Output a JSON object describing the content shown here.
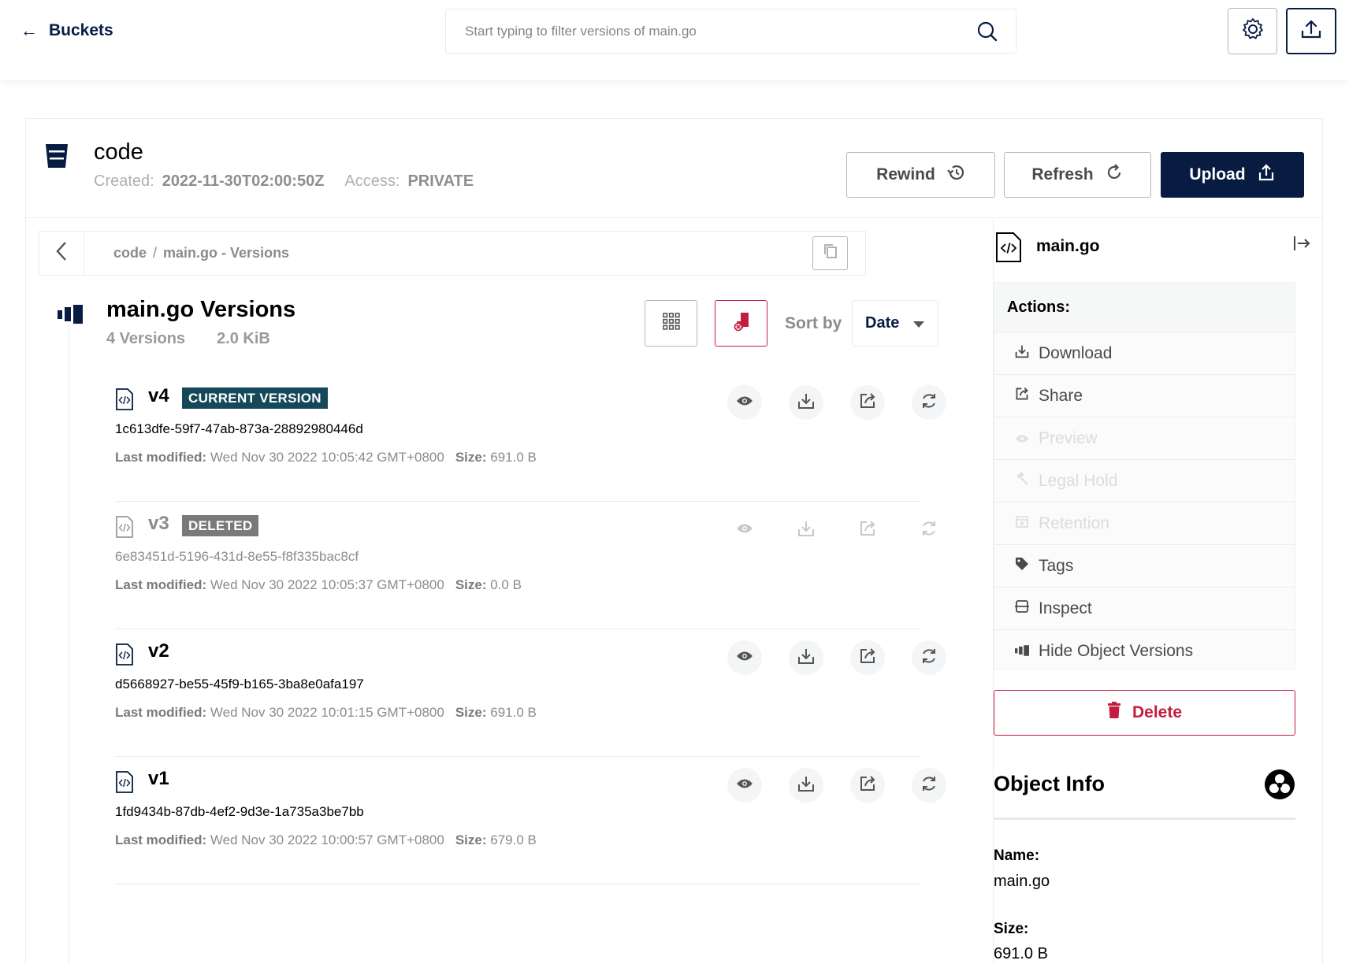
{
  "topbar": {
    "back_label": "Buckets",
    "search_placeholder": "Start typing to filter versions of main.go"
  },
  "bucket": {
    "name": "code",
    "created_label": "Created:",
    "created_value": "2022-11-30T02:00:50Z",
    "access_label": "Access:",
    "access_value": "PRIVATE",
    "buttons": {
      "rewind": "Rewind",
      "refresh": "Refresh",
      "upload": "Upload"
    }
  },
  "breadcrumb": {
    "root": "code",
    "separator": "/",
    "current": "main.go - Versions"
  },
  "versions": {
    "title": "main.go Versions",
    "count": "4 Versions",
    "size": "2.0 KiB",
    "sort_label": "Sort by",
    "sort_value": "Date",
    "items": [
      {
        "name": "v4",
        "badge": "CURRENT VERSION",
        "id": "1c613dfe-59f7-47ab-873a-28892980446d",
        "modified_label": "Last modified:",
        "modified": "Wed Nov 30 2022 10:05:42 GMT+0800",
        "size_label": "Size:",
        "size": "691.0 B"
      },
      {
        "name": "v3",
        "badge": "DELETED",
        "id": "6e83451d-5196-431d-8e55-f8f335bac8cf",
        "modified_label": "Last modified:",
        "modified": "Wed Nov 30 2022 10:05:37 GMT+0800",
        "size_label": "Size:",
        "size": "0.0 B"
      },
      {
        "name": "v2",
        "badge": "",
        "id": "d5668927-be55-45f9-b165-3ba8e0afa197",
        "modified_label": "Last modified:",
        "modified": "Wed Nov 30 2022 10:01:15 GMT+0800",
        "size_label": "Size:",
        "size": "691.0 B"
      },
      {
        "name": "v1",
        "badge": "",
        "id": "1fd9434b-87db-4ef2-9d3e-1a735a3be7bb",
        "modified_label": "Last modified:",
        "modified": "Wed Nov 30 2022 10:00:57 GMT+0800",
        "size_label": "Size:",
        "size": "679.0 B"
      }
    ]
  },
  "panel": {
    "filename": "main.go",
    "actions_title": "Actions:",
    "actions": [
      {
        "label": "Download",
        "icon": "download-icon",
        "enabled": true
      },
      {
        "label": "Share",
        "icon": "share-icon",
        "enabled": true
      },
      {
        "label": "Preview",
        "icon": "eye-icon",
        "enabled": false
      },
      {
        "label": "Legal Hold",
        "icon": "gavel-icon",
        "enabled": false
      },
      {
        "label": "Retention",
        "icon": "calendar-icon",
        "enabled": false
      },
      {
        "label": "Tags",
        "icon": "tag-icon",
        "enabled": true
      },
      {
        "label": "Inspect",
        "icon": "inspect-icon",
        "enabled": true
      },
      {
        "label": "Hide Object Versions",
        "icon": "versions-icon",
        "enabled": true
      }
    ],
    "delete_label": "Delete",
    "object_info_title": "Object Info",
    "info": [
      {
        "label": "Name:",
        "value": "main.go"
      },
      {
        "label": "Size:",
        "value": "691.0 B"
      }
    ]
  },
  "colors": {
    "primary": "#081c42",
    "danger": "#c51b3f",
    "badge_current": "#15495a",
    "badge_deleted": "#7a7a7a"
  }
}
